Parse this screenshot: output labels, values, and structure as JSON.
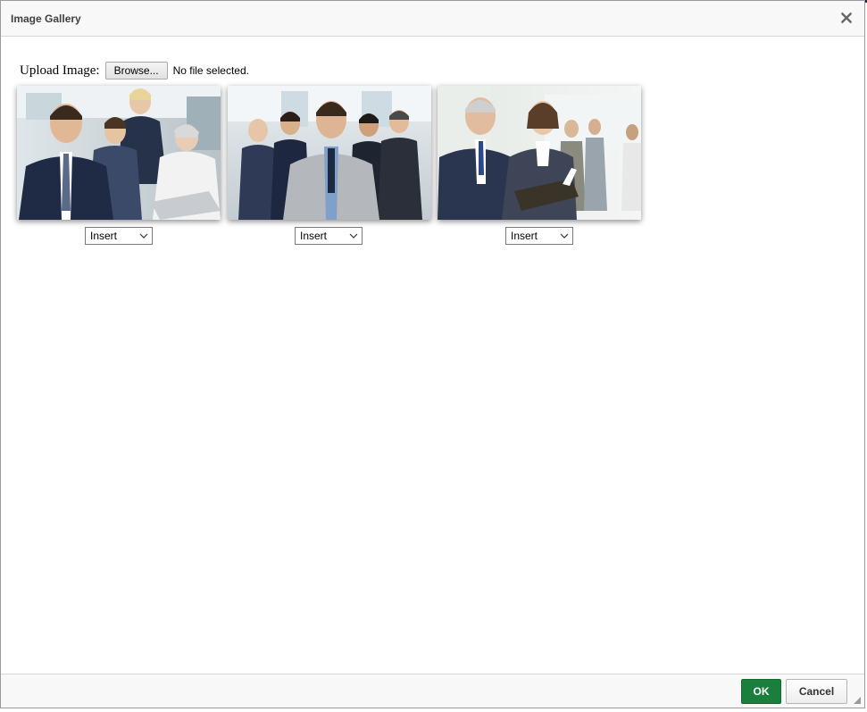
{
  "dialog": {
    "title": "Image Gallery",
    "close_icon": "close-icon"
  },
  "upload": {
    "label": "Upload Image:",
    "browse_label": "Browse...",
    "file_status": "No file selected."
  },
  "gallery": {
    "images": [
      {
        "description_icon": "business-team-photo-1",
        "action": "Insert"
      },
      {
        "description_icon": "business-team-photo-2",
        "action": "Insert"
      },
      {
        "description_icon": "business-meeting-photo-3",
        "action": "Insert"
      }
    ]
  },
  "footer": {
    "ok_label": "OK",
    "cancel_label": "Cancel"
  },
  "colors": {
    "ok_button": "#1a7f3c",
    "title_text": "#404040"
  }
}
